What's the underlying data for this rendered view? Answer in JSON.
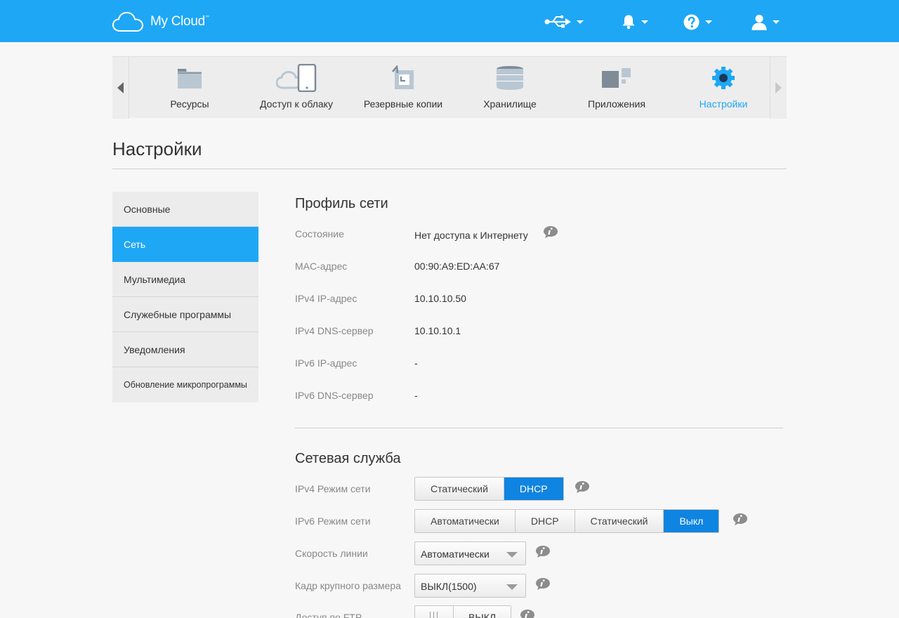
{
  "app": {
    "brand": "My Cloud",
    "trademark": "™"
  },
  "header_icons": [
    "usb-icon",
    "bell-icon",
    "help-icon",
    "user-icon"
  ],
  "nav": {
    "items": [
      {
        "label": "Ресурсы",
        "icon": "folder-icon"
      },
      {
        "label": "Доступ к облаку",
        "icon": "cloud-access-icon"
      },
      {
        "label": "Резервные копии",
        "icon": "backup-icon"
      },
      {
        "label": "Хранилище",
        "icon": "storage-icon"
      },
      {
        "label": "Приложения",
        "icon": "apps-icon"
      },
      {
        "label": "Настройки",
        "icon": "gear-icon",
        "active": true
      }
    ]
  },
  "page": {
    "title": "Настройки"
  },
  "sidebar": {
    "items": [
      {
        "label": "Основные"
      },
      {
        "label": "Сеть",
        "active": true
      },
      {
        "label": "Мультимедиа"
      },
      {
        "label": "Служебные программы"
      },
      {
        "label": "Уведомления"
      },
      {
        "label": "Обновление микропрограммы"
      }
    ]
  },
  "network_profile": {
    "title": "Профиль сети",
    "rows": [
      {
        "label": "Состояние",
        "value": "Нет доступа к Интернету"
      },
      {
        "label": "MAC-адрес",
        "value": "00:90:A9:ED:AA:67"
      },
      {
        "label": "IPv4 IP-адрес",
        "value": "10.10.10.50"
      },
      {
        "label": "IPv4 DNS-сервер",
        "value": "10.10.10.1"
      },
      {
        "label": "IPv6 IP-адрес",
        "value": "-"
      },
      {
        "label": "IPv6 DNS-сервер",
        "value": "-"
      }
    ]
  },
  "network_service": {
    "title": "Сетевая служба",
    "ipv4_mode": {
      "label": "IPv4 Режим сети",
      "options": [
        "Статический",
        "DHCP"
      ],
      "selected": "DHCP"
    },
    "ipv6_mode": {
      "label": "IPv6 Режим сети",
      "options": [
        "Автоматически",
        "DHCP",
        "Статический",
        "Выкл"
      ],
      "selected": "Выкл"
    },
    "link_speed": {
      "label": "Скорость линии",
      "value": "Автоматически"
    },
    "jumbo_frame": {
      "label": "Кадр крупного размера",
      "value": "ВЫКЛ(1500)"
    },
    "ftp": {
      "label": "Доступ по FTP",
      "value": "ВЫКЛ"
    }
  },
  "colors": {
    "accent": "#1ea7f5",
    "button_on": "#0f84e0",
    "info_icon": "#8c8c8c"
  }
}
